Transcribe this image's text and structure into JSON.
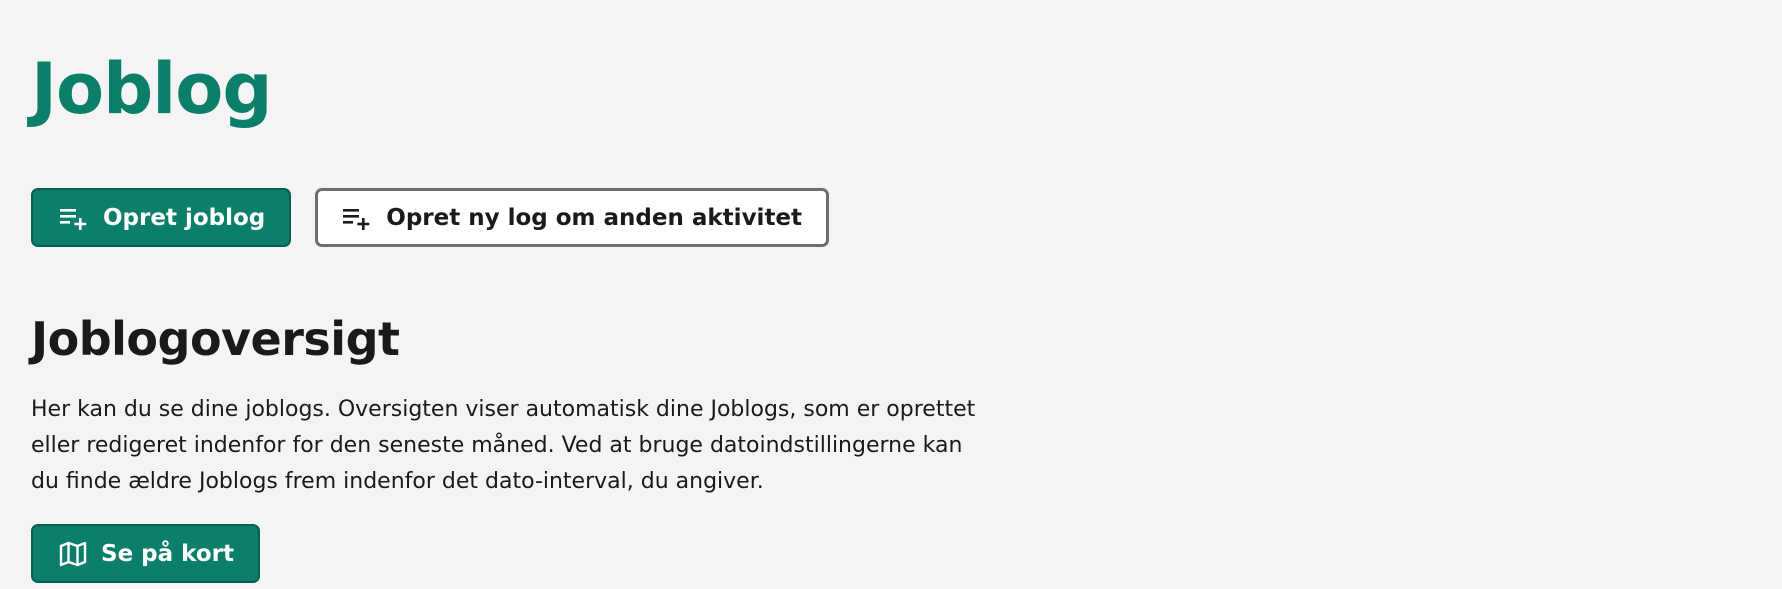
{
  "header": {
    "title": "Joblog"
  },
  "actions": {
    "create_joblog_label": "Opret joblog",
    "create_other_activity_label": "Opret ny log om anden aktivitet",
    "create_icon": "playlist-add-icon"
  },
  "overview": {
    "title": "Joblogoversigt",
    "description": "Her kan du se dine joblogs. Oversigten viser automatisk dine Joblogs, som er oprettet eller redigeret indenfor for den seneste måned. Ved at bruge datoindstillingerne kan du finde ældre Joblogs frem indenfor det dato-interval, du angiver.",
    "map_button_label": "Se på kort",
    "map_icon": "map-icon"
  },
  "colors": {
    "brand": "#0b7f6a",
    "background": "#f4f4f4",
    "text": "#1a1a1a",
    "secondary_border": "#6e6e6e"
  }
}
